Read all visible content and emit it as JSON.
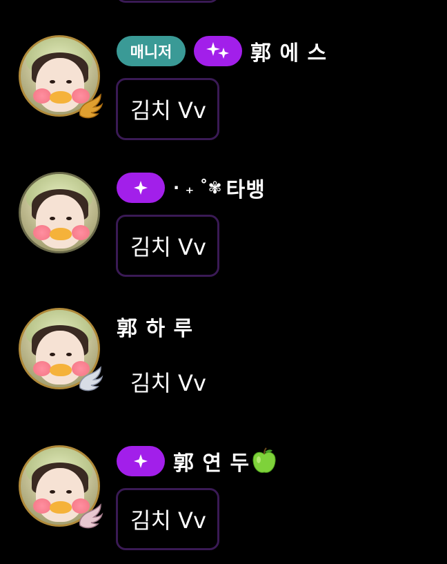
{
  "messages": [
    {
      "role_badge": "매니저",
      "has_sparkle_badge": true,
      "sparkle_type": "double",
      "nickname": "郭 에 스",
      "message": "김치 Vv",
      "wing_color": "gold"
    },
    {
      "role_badge": "",
      "has_sparkle_badge": true,
      "sparkle_type": "single",
      "nickname_prefix": "· ₊ ˚✾",
      "nickname": "타뱅",
      "message": "김치 Vv",
      "wing_color": "none"
    },
    {
      "role_badge": "",
      "has_sparkle_badge": false,
      "nickname": "郭 하 루",
      "message": "김치 Vv",
      "wing_color": "silver"
    },
    {
      "role_badge": "",
      "has_sparkle_badge": true,
      "sparkle_type": "single",
      "nickname": "郭 연 두",
      "nickname_suffix_icon": "green-apple",
      "message": "김치 Vv",
      "wing_color": "pink-silver"
    }
  ],
  "colors": {
    "background": "#000000",
    "manager_badge": "#3a9a96",
    "sparkle_badge": "#a21fea",
    "bubble_border": "#3a1a55"
  }
}
